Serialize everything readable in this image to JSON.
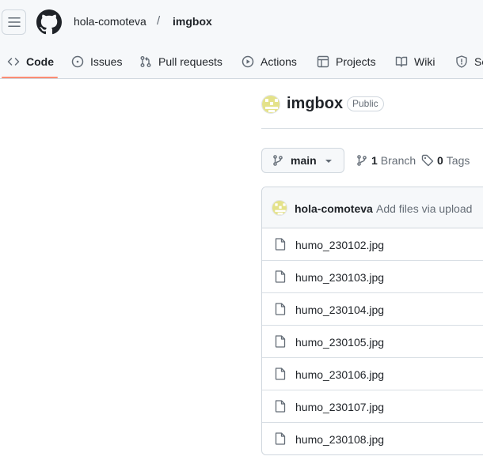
{
  "header": {
    "owner": "hola-comoteva",
    "separator": "/",
    "repo": "imgbox"
  },
  "tabs": [
    {
      "label": "Code",
      "icon": "code-icon",
      "active": true
    },
    {
      "label": "Issues",
      "icon": "issue-icon"
    },
    {
      "label": "Pull requests",
      "icon": "pull-request-icon"
    },
    {
      "label": "Actions",
      "icon": "play-icon"
    },
    {
      "label": "Projects",
      "icon": "table-icon"
    },
    {
      "label": "Wiki",
      "icon": "book-icon"
    },
    {
      "label": "Se",
      "icon": "shield-icon"
    }
  ],
  "repo": {
    "name": "imgbox",
    "visibility": "Public"
  },
  "branch": {
    "current": "main",
    "branch_count": "1",
    "branch_label": "Branch",
    "tag_count": "0",
    "tag_label": "Tags"
  },
  "commit": {
    "author": "hola-comoteva",
    "message": "Add files via upload"
  },
  "files": [
    "humo_230102.jpg",
    "humo_230103.jpg",
    "humo_230104.jpg",
    "humo_230105.jpg",
    "humo_230106.jpg",
    "humo_230107.jpg",
    "humo_230108.jpg"
  ],
  "colors": {
    "tab_underline": "#fd8c73",
    "avatar_yellow": "#e4e28a",
    "header_bg": "#f6f8fa"
  }
}
